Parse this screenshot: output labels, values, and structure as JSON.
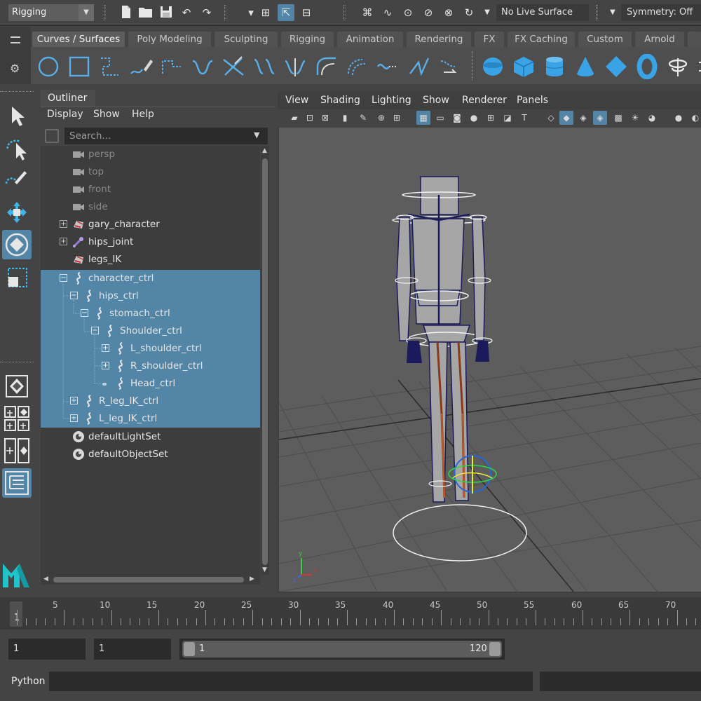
{
  "statusline": {
    "menu_set": "Rigging",
    "live_surface": "No Live Surface",
    "symmetry": "Symmetry: Off"
  },
  "shelf": {
    "tabs": [
      "Curves / Surfaces",
      "Poly Modeling",
      "Sculpting",
      "Rigging",
      "Animation",
      "Rendering",
      "FX",
      "FX Caching",
      "Custom",
      "Arnold"
    ],
    "active_tab": "Curves / Surfaces"
  },
  "outliner": {
    "title": "Outliner",
    "menu": [
      "Display",
      "Show",
      "Help"
    ],
    "search_placeholder": "Search...",
    "items": [
      {
        "label": "persp",
        "icon": "camera-icon"
      },
      {
        "label": "top",
        "icon": "camera-icon"
      },
      {
        "label": "front",
        "icon": "camera-icon"
      },
      {
        "label": "side",
        "icon": "camera-icon"
      },
      {
        "label": "gary_character",
        "icon": "mesh-icon"
      },
      {
        "label": "hips_joint",
        "icon": "joint-icon"
      },
      {
        "label": "legs_IK",
        "icon": "ik-handle-icon"
      },
      {
        "label": "character_ctrl",
        "icon": "curve-icon"
      },
      {
        "label": "hips_ctrl",
        "icon": "curve-icon"
      },
      {
        "label": "stomach_ctrl",
        "icon": "curve-icon"
      },
      {
        "label": "Shoulder_ctrl",
        "icon": "curve-icon"
      },
      {
        "label": "L_shoulder_ctrl",
        "icon": "curve-icon"
      },
      {
        "label": "R_shoulder_ctrl",
        "icon": "curve-icon"
      },
      {
        "label": "Head_ctrl",
        "icon": "curve-icon"
      },
      {
        "label": "R_leg_IK_ctrl",
        "icon": "curve-icon"
      },
      {
        "label": "L_leg_IK_ctrl",
        "icon": "curve-icon"
      },
      {
        "label": "defaultLightSet",
        "icon": "set-icon"
      },
      {
        "label": "defaultObjectSet",
        "icon": "set-icon"
      }
    ]
  },
  "viewport": {
    "menu": [
      "View",
      "Shading",
      "Lighting",
      "Show",
      "Renderer",
      "Panels"
    ],
    "axis": {
      "y": "y",
      "x": "x",
      "z": "z"
    }
  },
  "timeslider": {
    "ticks": [
      "5",
      "10",
      "15",
      "20",
      "25",
      "30",
      "35",
      "40",
      "45",
      "50",
      "55",
      "60",
      "65",
      "70"
    ],
    "current_frame": "1"
  },
  "rangeslider": {
    "start_field": "1",
    "playback_start": "1",
    "range_start": "1",
    "range_end": "120"
  },
  "cmdline": {
    "language": "Python"
  },
  "colors": {
    "selection": "#5285a6",
    "panel": "#444444",
    "field": "#2b2b2b",
    "viewport_bg": "#5d5d5d",
    "maya_logo": "#1fc3c8"
  }
}
